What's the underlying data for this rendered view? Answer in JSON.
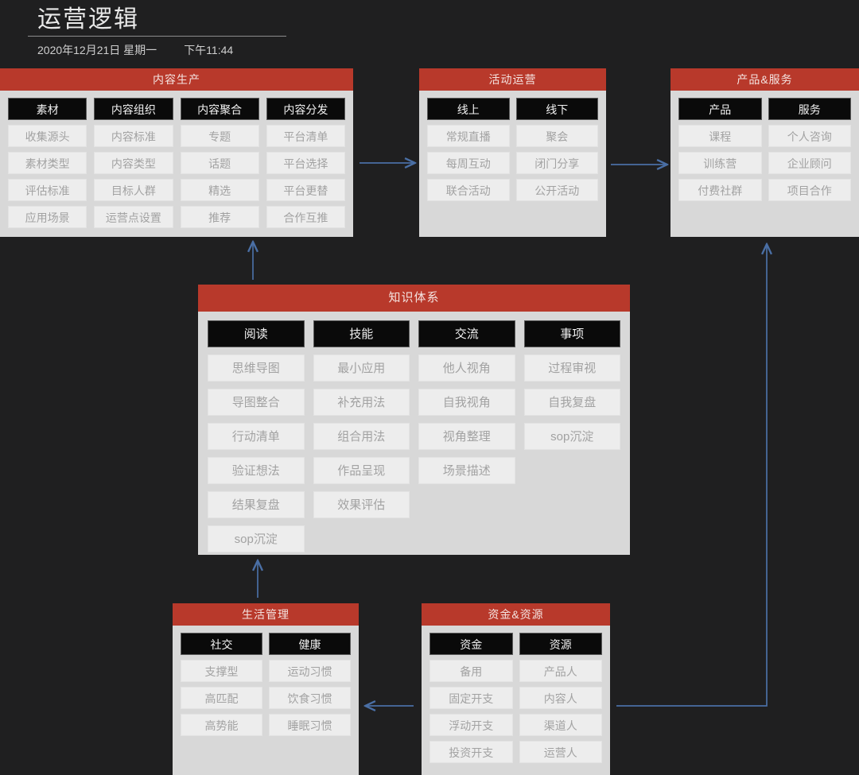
{
  "header": {
    "title": "运营逻辑",
    "date": "2020年12月21日 星期一",
    "time": "下午11:44"
  },
  "colors": {
    "background": "#1f1f20",
    "card_header": "#b8392b",
    "card_body": "#d8d8d8",
    "chip_head": "#0a0a0a",
    "chip_item": "#ededed",
    "arrow": "#4a6fa5",
    "title_text": "#e9e9e9"
  },
  "cards": [
    {
      "id": "content-production",
      "title": "内容生产",
      "columns": [
        {
          "head": "素材",
          "items": [
            "收集源头",
            "素材类型",
            "评估标准",
            "应用场景"
          ]
        },
        {
          "head": "内容组织",
          "items": [
            "内容标准",
            "内容类型",
            "目标人群",
            "运营点设置"
          ]
        },
        {
          "head": "内容聚合",
          "items": [
            "专题",
            "话题",
            "精选",
            "推荐"
          ]
        },
        {
          "head": "内容分发",
          "items": [
            "平台清单",
            "平台选择",
            "平台更替",
            "合作互推"
          ]
        }
      ]
    },
    {
      "id": "activity-operation",
      "title": "活动运营",
      "columns": [
        {
          "head": "线上",
          "items": [
            "常规直播",
            "每周互动",
            "联合活动"
          ]
        },
        {
          "head": "线下",
          "items": [
            "聚会",
            "闭门分享",
            "公开活动"
          ]
        }
      ]
    },
    {
      "id": "product-service",
      "title": "产品&服务",
      "columns": [
        {
          "head": "产品",
          "items": [
            "课程",
            "训练营",
            "付费社群"
          ]
        },
        {
          "head": "服务",
          "items": [
            "个人咨询",
            "企业顾问",
            "项目合作"
          ]
        }
      ]
    },
    {
      "id": "knowledge-system",
      "title": "知识体系",
      "columns": [
        {
          "head": "阅读",
          "items": [
            "思维导图",
            "导图整合",
            "行动清单",
            "验证想法",
            "结果复盘",
            "sop沉淀"
          ]
        },
        {
          "head": "技能",
          "items": [
            "最小应用",
            "补充用法",
            "组合用法",
            "作品呈现",
            "效果评估"
          ]
        },
        {
          "head": "交流",
          "items": [
            "他人视角",
            "自我视角",
            "视角整理",
            "场景描述"
          ]
        },
        {
          "head": "事项",
          "items": [
            "过程审视",
            "自我复盘",
            "sop沉淀"
          ]
        }
      ]
    },
    {
      "id": "life-management",
      "title": "生活管理",
      "columns": [
        {
          "head": "社交",
          "items": [
            "支撑型",
            "高匹配",
            "高势能"
          ]
        },
        {
          "head": "健康",
          "items": [
            "运动习惯",
            "饮食习惯",
            "睡眠习惯"
          ]
        }
      ]
    },
    {
      "id": "funds-resources",
      "title": "资金&资源",
      "columns": [
        {
          "head": "资金",
          "items": [
            "备用",
            "固定开支",
            "浮动开支",
            "投资开支"
          ]
        },
        {
          "head": "资源",
          "items": [
            "产品人",
            "内容人",
            "渠道人",
            "运营人"
          ]
        }
      ]
    }
  ],
  "connections": [
    {
      "name": "content-production-to-activity-operation",
      "direction": "right"
    },
    {
      "name": "activity-operation-to-product-service",
      "direction": "right"
    },
    {
      "name": "knowledge-system-to-content-production",
      "direction": "up"
    },
    {
      "name": "life-management-to-knowledge-system",
      "direction": "up"
    },
    {
      "name": "funds-resources-to-life-management",
      "direction": "left"
    },
    {
      "name": "funds-resources-to-product-service",
      "direction": "up-elbow"
    }
  ]
}
